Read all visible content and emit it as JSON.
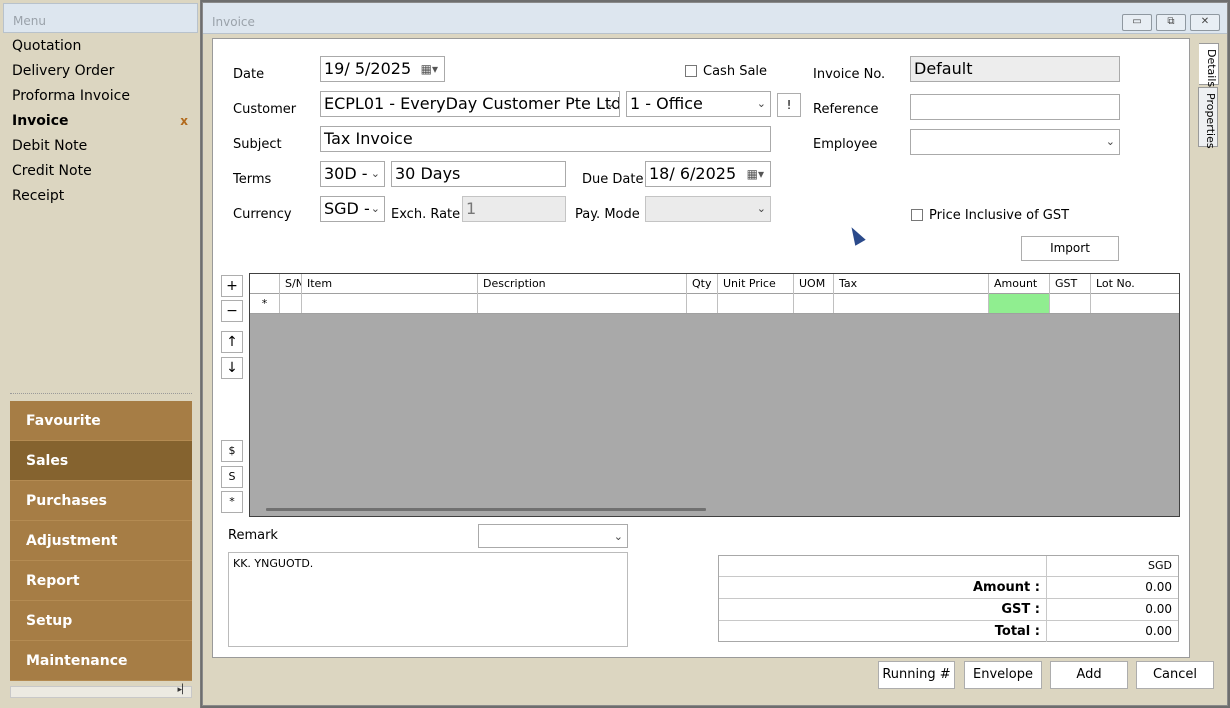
{
  "menu": {
    "title": "Menu",
    "items": [
      {
        "label": "Quotation"
      },
      {
        "label": "Delivery Order"
      },
      {
        "label": "Proforma Invoice"
      },
      {
        "label": "Invoice"
      },
      {
        "label": "Debit Note"
      },
      {
        "label": "Credit Note"
      },
      {
        "label": "Receipt"
      }
    ],
    "close_mark": "x",
    "categories": [
      {
        "label": "Favourite"
      },
      {
        "label": "Sales"
      },
      {
        "label": "Purchases"
      },
      {
        "label": "Adjustment"
      },
      {
        "label": "Report"
      },
      {
        "label": "Setup"
      },
      {
        "label": "Maintenance"
      }
    ]
  },
  "window": {
    "title": "Invoice",
    "side_tabs": {
      "details": "Details",
      "properties": "Properties"
    }
  },
  "form": {
    "date_label": "Date",
    "date_value": "19/  5/2025",
    "cash_sale_label": "Cash Sale",
    "invoice_no_label": "Invoice No.",
    "invoice_no_value": "Default",
    "customer_label": "Customer",
    "customer_value": "ECPL01 - EveryDay Customer Pte Ltd",
    "branch_value": "1 - Office",
    "bang_label": "!",
    "reference_label": "Reference",
    "reference_value": "",
    "subject_label": "Subject",
    "subject_value": "Tax Invoice",
    "employee_label": "Employee",
    "employee_value": "",
    "terms_label": "Terms",
    "terms_code": "30D -",
    "terms_desc": "30 Days",
    "due_date_label": "Due Date",
    "due_date_value": "18/  6/2025",
    "currency_label": "Currency",
    "currency_value": "SGD -",
    "exch_rate_label": "Exch. Rate",
    "exch_rate_value": "1",
    "pay_mode_label": "Pay. Mode",
    "pay_mode_value": "",
    "price_incl_label": "Price Inclusive of GST",
    "import_label": "Import"
  },
  "grid": {
    "columns": [
      "S/N",
      "Item",
      "Description",
      "Qty",
      "Unit Price",
      "UOM",
      "Tax",
      "Amount",
      "GST",
      "Lot No."
    ],
    "new_row_marker": "*",
    "tools": {
      "add": "+",
      "remove": "−",
      "up": "↑",
      "down": "↓",
      "dollar": "$",
      "s": "S",
      "star": "*"
    }
  },
  "remark": {
    "label": "Remark",
    "text": "KK. YNGUOTD."
  },
  "totals": {
    "currency": "SGD",
    "rows": [
      {
        "label": "Amount :",
        "value": "0.00"
      },
      {
        "label": "GST :",
        "value": "0.00"
      },
      {
        "label": "Total :",
        "value": "0.00"
      }
    ]
  },
  "actions": {
    "running": "Running #",
    "envelope": "Envelope",
    "add": "Add",
    "cancel": "Cancel"
  }
}
